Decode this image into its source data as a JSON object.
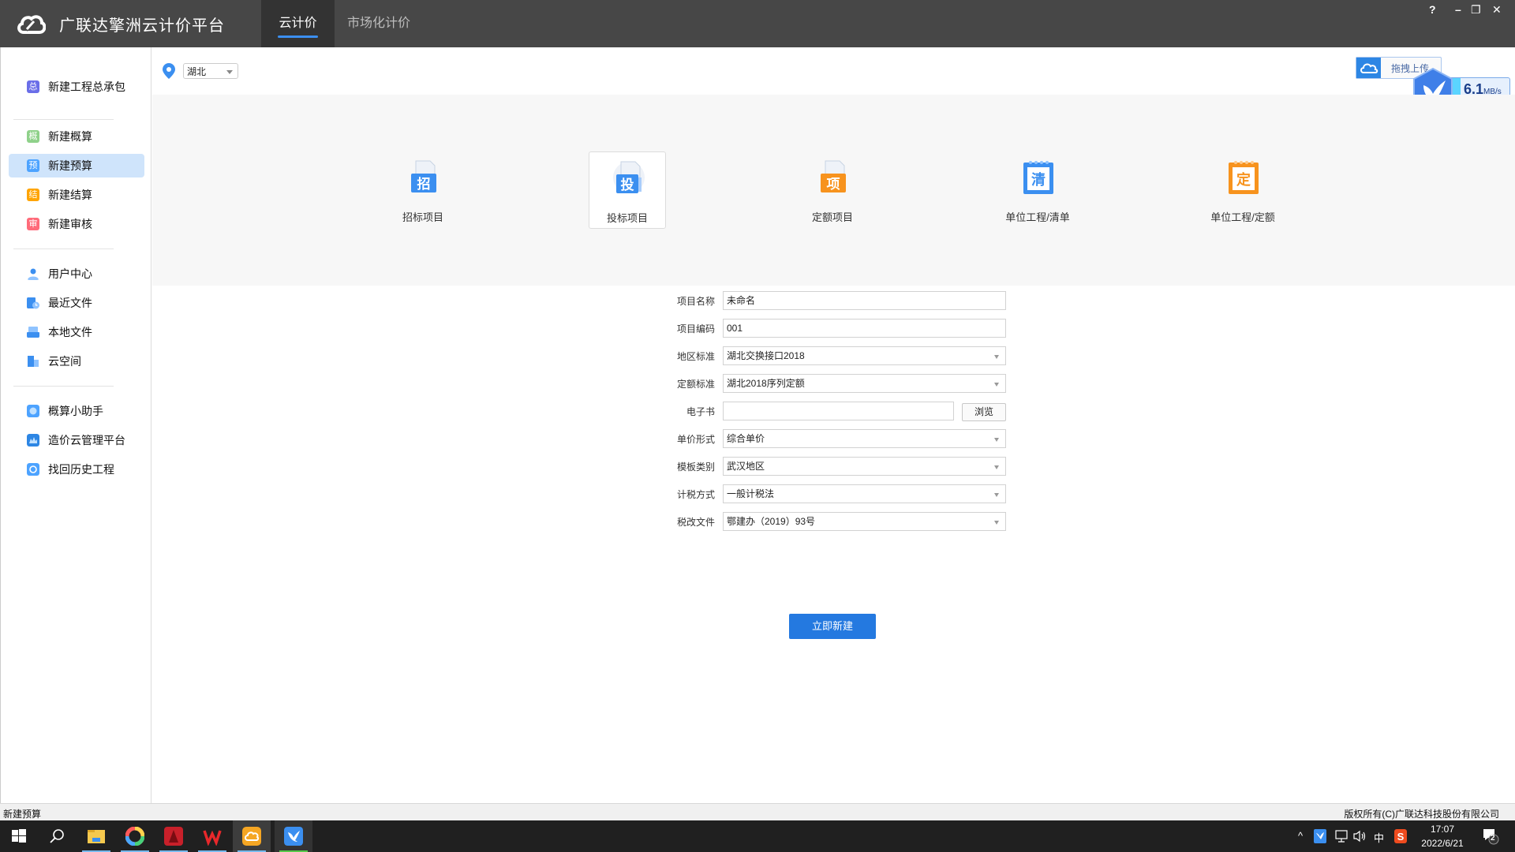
{
  "app": {
    "title": "广联达擎洲云计价平台",
    "logo_icon": "cloud-link-logo-icon",
    "tabs": [
      {
        "label": "云计价",
        "active": true
      },
      {
        "label": "市场化计价",
        "active": false
      }
    ],
    "window_controls": {
      "help": "?",
      "minimize": "–",
      "restore": "❐",
      "close": "✕"
    }
  },
  "sidebar": {
    "groups": [
      [
        {
          "label": "新建工程总承包",
          "icon": "总",
          "color": "#6a6ee8"
        }
      ],
      [
        {
          "label": "新建概算",
          "icon": "概",
          "color": "#8fd18a"
        },
        {
          "label": "新建预算",
          "icon": "预",
          "color": "#4da3ff",
          "selected": true
        },
        {
          "label": "新建结算",
          "icon": "结",
          "color": "#ffa400"
        },
        {
          "label": "新建审核",
          "icon": "审",
          "color": "#ff6b7a"
        }
      ],
      [
        {
          "label": "用户中心",
          "icon": "user-icon",
          "color": "#3b8ff0"
        },
        {
          "label": "最近文件",
          "icon": "recent-file-icon",
          "color": "#3b8ff0"
        },
        {
          "label": "本地文件",
          "icon": "local-file-icon",
          "color": "#3b8ff0"
        },
        {
          "label": "云空间",
          "icon": "cloud-space-icon",
          "color": "#3b8ff0"
        }
      ],
      [
        {
          "label": "概算小助手",
          "icon": "assistant-icon",
          "color": "#4da3ff"
        },
        {
          "label": "造价云管理平台",
          "icon": "cloud-platform-icon",
          "color": "#2d86e4"
        },
        {
          "label": "找回历史工程",
          "icon": "history-icon",
          "color": "#4da3ff"
        }
      ]
    ]
  },
  "region": {
    "selected": "湖北"
  },
  "upload": {
    "label": "拖拽上传",
    "speed_value": "6.1",
    "speed_unit": "MB/s"
  },
  "project_types": [
    {
      "label": "招标项目",
      "glyph": "招",
      "color": "#3b8ff0",
      "selected": false
    },
    {
      "label": "投标项目",
      "glyph": "投",
      "color": "#3b8ff0",
      "selected": true
    },
    {
      "label": "定额项目",
      "glyph": "项",
      "color": "#f7931e",
      "selected": false
    },
    {
      "label": "单位工程/清单",
      "glyph": "清",
      "color": "#3b8ff0",
      "selected": false
    },
    {
      "label": "单位工程/定额",
      "glyph": "定",
      "color": "#f7931e",
      "selected": false
    }
  ],
  "form": {
    "project_name": {
      "label": "项目名称",
      "value": "未命名"
    },
    "project_code": {
      "label": "项目编码",
      "value": "001"
    },
    "region_standard": {
      "label": "地区标准",
      "value": "湖北交换接口2018"
    },
    "quota_standard": {
      "label": "定额标准",
      "value": "湖北2018序列定额"
    },
    "ebook": {
      "label": "电子书",
      "value": "",
      "browse_label": "浏览"
    },
    "price_form": {
      "label": "单价形式",
      "value": "综合单价"
    },
    "template_type": {
      "label": "模板类别",
      "value": "武汉地区"
    },
    "tax_method": {
      "label": "计税方式",
      "value": "一般计税法"
    },
    "tax_file": {
      "label": "税改文件",
      "value": "鄂建办（2019）93号"
    },
    "create_label": "立即新建"
  },
  "statusbar": {
    "left": "新建预算",
    "right": "版权所有(C)广联达科技股份有限公司"
  },
  "taskbar": {
    "apps": [
      "windows-start",
      "search",
      "file-explorer",
      "color-app",
      "autocad",
      "wps",
      "glodon-cloud",
      "xunlei"
    ],
    "tray": {
      "ime": "中",
      "time": "17:07",
      "date": "2022/6/21",
      "notifications": "2"
    }
  }
}
